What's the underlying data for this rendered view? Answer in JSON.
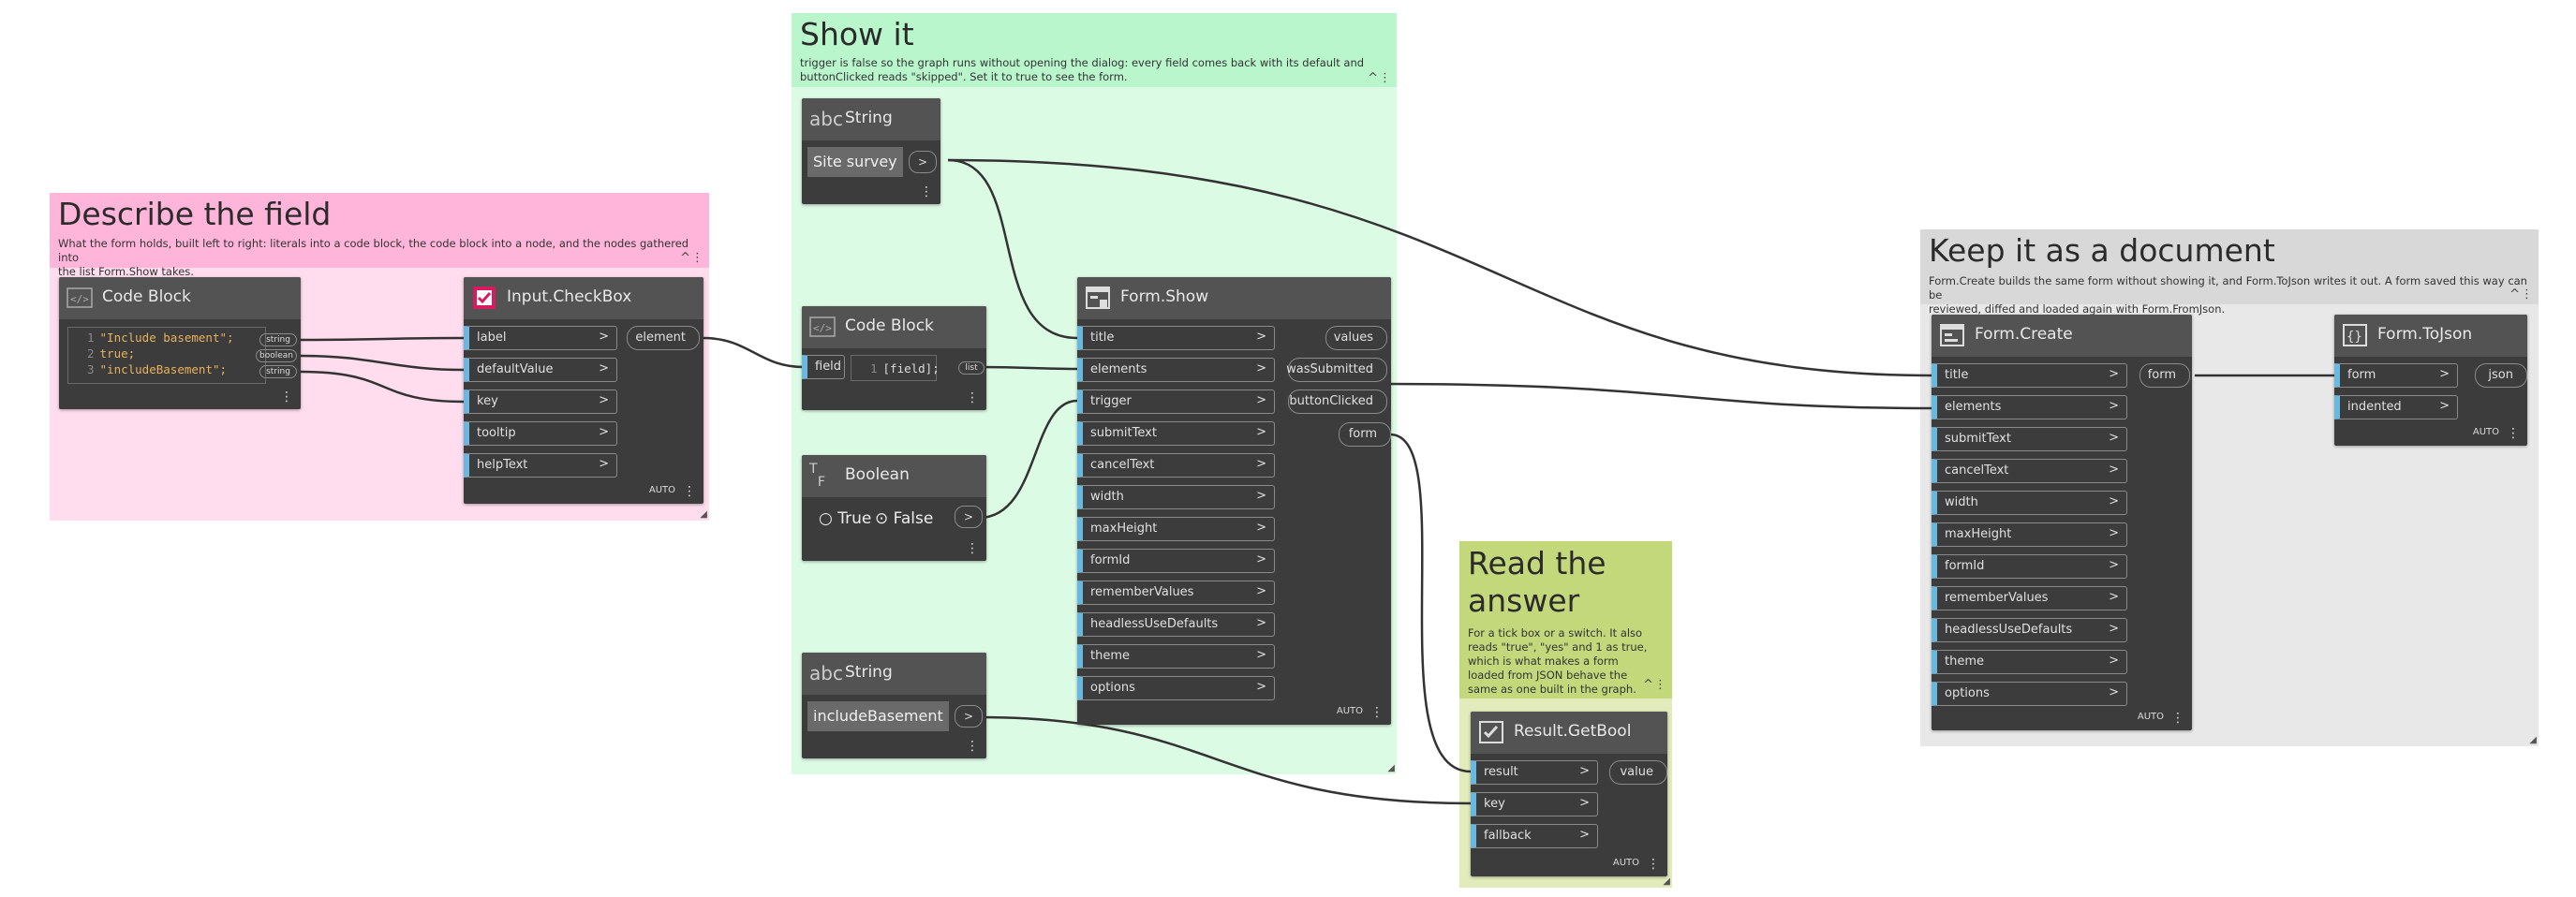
{
  "colors": {
    "group_pink_head": "#ffb5da",
    "group_pink_body": "#ffdcee",
    "group_green_head": "#b9f6cc",
    "group_green_body": "#dcfbe5",
    "group_olive_head": "#c3d87a",
    "group_olive_body": "#e1ebbb",
    "group_gray_head": "#d8d8d8",
    "group_gray_body": "#e8e8e8",
    "node_body": "#3c3c3c",
    "node_header": "#535353",
    "input_port_accent": "#6ab7e0",
    "wire": "#333333"
  },
  "groups": {
    "describe": {
      "title": "Describe the field",
      "description_lines": [
        "What the form holds, built left to right: literals into a code block, the code block into a node, and the nodes gathered into",
        "the list Form.Show takes."
      ]
    },
    "show": {
      "title": "Show it",
      "description_lines": [
        "trigger is false so the graph runs without opening the dialog: every field comes back with its default and",
        "buttonClicked reads \"skipped\". Set it to true to see the form."
      ]
    },
    "read": {
      "title_lines": [
        "Read the",
        "answer"
      ],
      "description_lines": [
        "For a tick box or a switch. It also",
        "reads \"true\", \"yes\" and 1 as true,",
        "which is what makes a form",
        "loaded from JSON behave the",
        "same as one built in the graph."
      ]
    },
    "keep": {
      "title": "Keep it as a document",
      "description_lines": [
        "Form.Create builds the same form without showing it, and Form.ToJson writes it out. A form saved this way can be",
        "reviewed, diffed and loaded again with Form.FromJson."
      ]
    }
  },
  "group_controls": {
    "collapse": "^",
    "menu": "⋮"
  },
  "nodes": {
    "codeblock1": {
      "title": "Code Block",
      "icon": "code-block-icon",
      "lines": [
        {
          "num": "1",
          "text": "\"Include basement\";"
        },
        {
          "num": "2",
          "text": "true;"
        },
        {
          "num": "3",
          "text": "\"includeBasement\";"
        }
      ],
      "output_tags": [
        "string",
        "boolean",
        "string"
      ]
    },
    "checkbox": {
      "title": "Input.CheckBox",
      "icon": "checkbox-icon",
      "inputs": [
        "label",
        "defaultValue",
        "key",
        "tooltip",
        "helpText"
      ],
      "outputs": [
        "element"
      ],
      "lacing": "AUTO"
    },
    "string1": {
      "title": "String",
      "icon": "abc-string-icon",
      "value": "Site survey"
    },
    "codeblock2": {
      "title": "Code Block",
      "icon": "code-block-icon",
      "input": "field",
      "line": {
        "num": "1",
        "text": "[field];"
      },
      "output_tag": "list"
    },
    "boolean": {
      "title": "Boolean",
      "icon": "boolean-icon",
      "options": [
        "True",
        "False"
      ],
      "selected": "False"
    },
    "string2": {
      "title": "String",
      "icon": "abc-string-icon",
      "value": "includeBasement"
    },
    "formshow": {
      "title": "Form.Show",
      "icon": "form-show-icon",
      "inputs": [
        "title",
        "elements",
        "trigger",
        "submitText",
        "cancelText",
        "width",
        "maxHeight",
        "formId",
        "rememberValues",
        "headlessUseDefaults",
        "theme",
        "options"
      ],
      "outputs": [
        "values",
        "wasSubmitted",
        "buttonClicked",
        "form"
      ],
      "lacing": "AUTO"
    },
    "getbool": {
      "title": "Result.GetBool",
      "icon": "result-getbool-icon",
      "inputs": [
        "result",
        "key",
        "fallback"
      ],
      "outputs": [
        "value"
      ],
      "lacing": "AUTO"
    },
    "formcreate": {
      "title": "Form.Create",
      "icon": "form-create-icon",
      "inputs": [
        "title",
        "elements",
        "submitText",
        "cancelText",
        "width",
        "maxHeight",
        "formId",
        "rememberValues",
        "headlessUseDefaults",
        "theme",
        "options"
      ],
      "outputs": [
        "form"
      ],
      "lacing": "AUTO"
    },
    "tojson": {
      "title": "Form.ToJson",
      "icon": "form-tojson-icon",
      "inputs": [
        "form",
        "indented"
      ],
      "outputs": [
        "json"
      ],
      "lacing": "AUTO"
    }
  },
  "glyphs": {
    "port_arrow": ">",
    "node_menu": "⋮"
  }
}
